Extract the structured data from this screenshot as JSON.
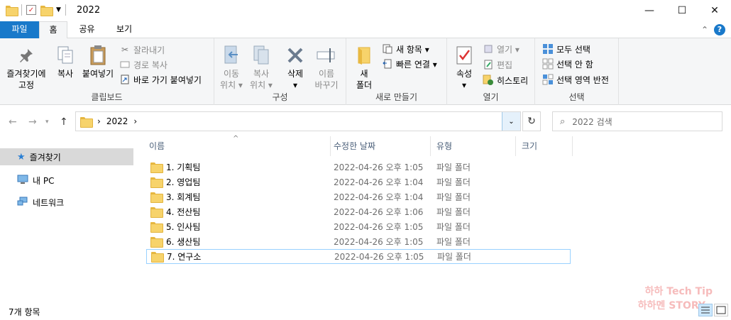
{
  "window": {
    "title": "2022",
    "controls": {
      "minimize": "—",
      "maximize": "☐",
      "close": "✕"
    }
  },
  "ribbon_tabs": [
    "파일",
    "홈",
    "공유",
    "보기"
  ],
  "ribbon": {
    "clipboard": {
      "label": "클립보드",
      "pin": "즐겨찾기에\n고정",
      "copy": "복사",
      "paste": "붙여넣기",
      "cut": "잘라내기",
      "copy_path": "경로 복사",
      "paste_shortcut": "바로 가기 붙여넣기"
    },
    "organize": {
      "label": "구성",
      "move": "이동\n위치 ▾",
      "copy_to": "복사\n위치 ▾",
      "delete": "삭제\n▾",
      "rename": "이름\n바꾸기"
    },
    "new": {
      "label": "새로 만들기",
      "new_folder": "새\n폴더",
      "new_item": "새 항목 ▾",
      "easy_access": "빠른 연결 ▾"
    },
    "open": {
      "label": "열기",
      "properties": "속성\n▾",
      "open": "열기 ▾",
      "edit": "편집",
      "history": "히스토리"
    },
    "select": {
      "label": "선택",
      "select_all": "모두 선택",
      "select_none": "선택 안 함",
      "invert": "선택 영역 반전"
    }
  },
  "address": {
    "crumbs": [
      "›",
      "2022",
      "›"
    ],
    "search_placeholder": "2022 검색"
  },
  "nav_pane": {
    "items": [
      {
        "label": "즐겨찾기",
        "icon": "star-icon"
      },
      {
        "label": "내 PC",
        "icon": "pc-icon"
      },
      {
        "label": "네트워크",
        "icon": "network-icon"
      }
    ]
  },
  "columns": {
    "name": "이름",
    "date": "수정한 날짜",
    "type": "유형",
    "size": "크기"
  },
  "files": [
    {
      "name": "1. 기획팀",
      "date": "2022-04-26 오후 1:05",
      "type": "파일 폴더"
    },
    {
      "name": "2. 영업팀",
      "date": "2022-04-26 오후 1:04",
      "type": "파일 폴더"
    },
    {
      "name": "3. 회계팀",
      "date": "2022-04-26 오후 1:04",
      "type": "파일 폴더"
    },
    {
      "name": "4. 전산팀",
      "date": "2022-04-26 오후 1:06",
      "type": "파일 폴더"
    },
    {
      "name": "5. 인사팀",
      "date": "2022-04-26 오후 1:05",
      "type": "파일 폴더"
    },
    {
      "name": "6. 생산팀",
      "date": "2022-04-26 오후 1:05",
      "type": "파일 폴더"
    },
    {
      "name": "7. 연구소",
      "date": "2022-04-26 오후 1:05",
      "type": "파일 폴더"
    }
  ],
  "status": {
    "item_count": "7개 항목"
  },
  "watermark": {
    "line1": "하하 Tech Tip",
    "line2": "하하멘 STORY"
  },
  "colors": {
    "accent": "#1979ca",
    "folder": "#f7d36b",
    "selected_nav": "#d9d9d9"
  }
}
